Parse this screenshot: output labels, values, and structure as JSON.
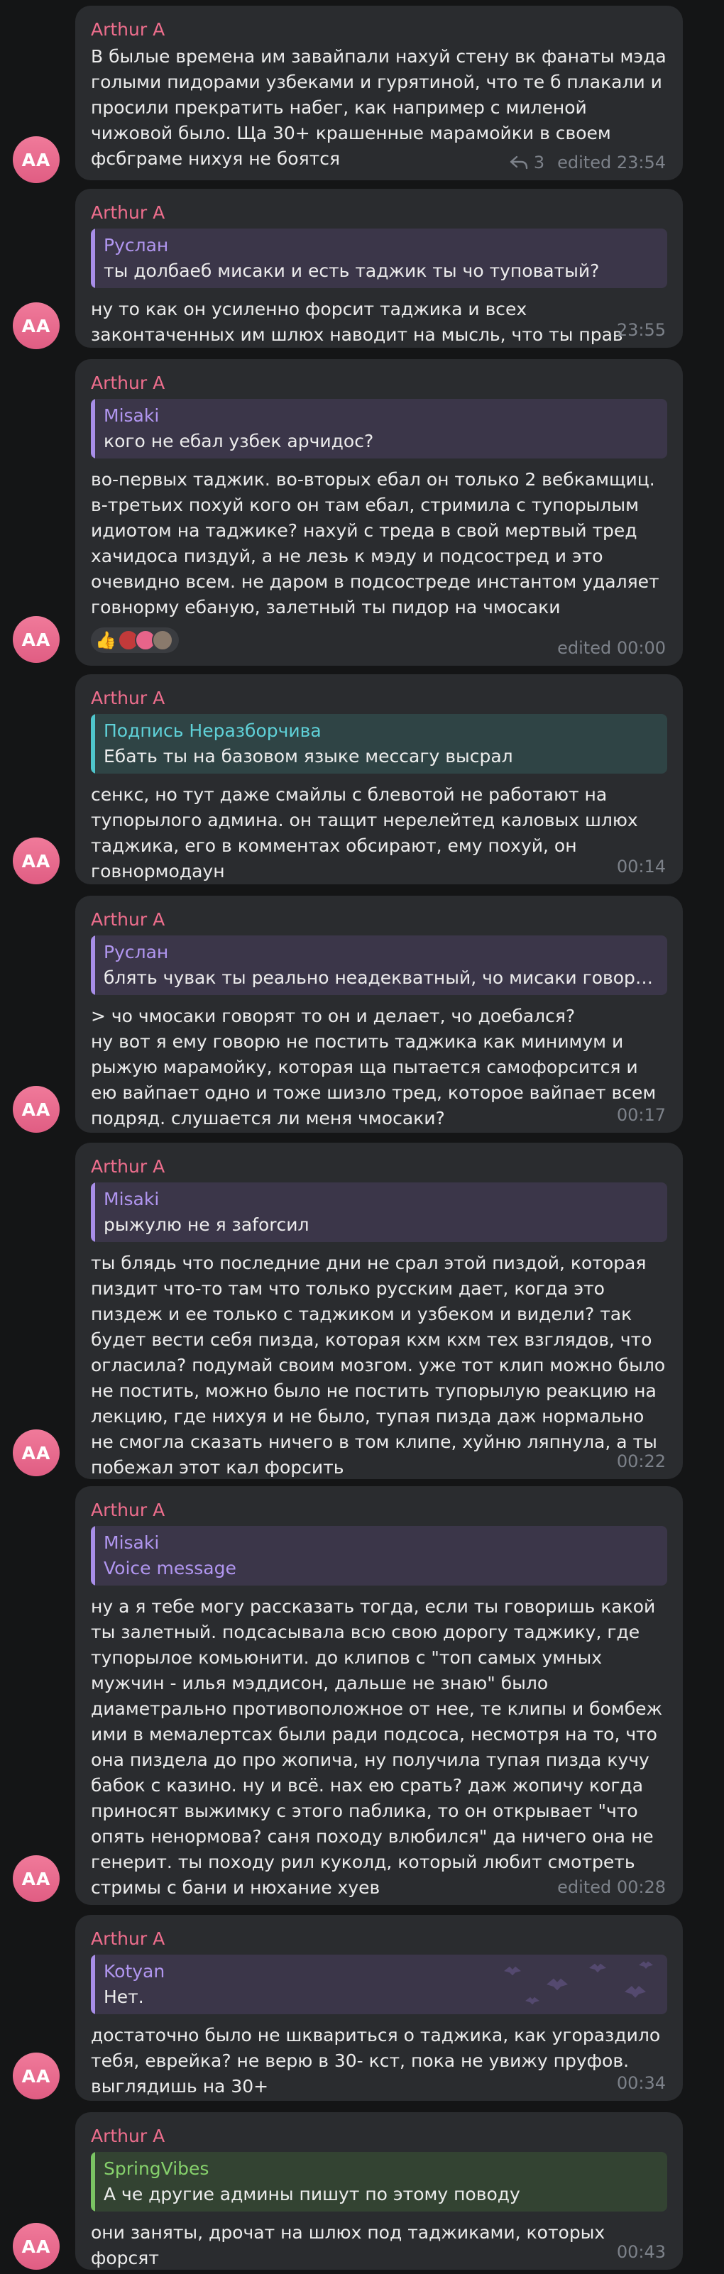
{
  "avatar_initials": "AA",
  "messages": [
    {
      "author": "Arthur A",
      "text": "В былые времена им завайпали нахуй стену вк фанаты мэда голыми пидорами узбеками и гурятиной, что те б плакали и просили прекратить набег, как например с миленой чижовой было. Ща 30+ крашенные марамойки в своем фсбграме нихуя не боятся",
      "reply_count": "3",
      "meta": "edited 23:54"
    },
    {
      "author": "Arthur A",
      "quote_name": "Руслан",
      "quote_text": "ты долбаеб мисаки и есть таджик ты чо туповатый?",
      "text": "ну то как он усиленно форсит таджика и всех законтаченных им шлюх наводит на мысль, что ты прав",
      "meta": "23:55"
    },
    {
      "author": "Arthur A",
      "quote_name": "Misaki",
      "quote_text": "кого не ебал узбек арчидос?",
      "text": "во-первых таджик. во-вторых ебал он только 2 вебкамщиц. в-третьих похуй кого он там ебал, стримила с тупорылым идиотом на таджике? нахуй с треда в свой мертвый тред хачидоса пиздуй, а не лезь к мэду и подсостред и это очевидно всем. не даром в подсостреде инстантом удаляет говнорму ебаную, залетный ты пидор на чмосаки",
      "reaction": "👍",
      "meta": "edited 00:00"
    },
    {
      "author": "Arthur A",
      "quote_name": "Подпись Неразборчива",
      "quote_text": "Ебать ты на базовом языке мессагу высрал",
      "text": "сенкс, но тут даже смайлы с блевотой не работают на тупорылого админа. он тащит нерелейтед каловых шлюх таджика, его в комментах обсирают, ему похуй, он говнормодаун",
      "meta": "00:14"
    },
    {
      "author": "Arthur A",
      "quote_name": "Руслан",
      "quote_text": "блять чувак ты реально неадекватный, чо мисаки говорят ...",
      "text": "> чо чмосаки говорят то он и делает, чо доебался?\nну вот я ему говорю не постить таджика как минимум и рыжую марамойку, которая ща пытается самофорсится и ею вайпает одно и тоже шизло тред, которое вайпает всем подряд. слушается ли меня чмосаки?",
      "meta": "00:17"
    },
    {
      "author": "Arthur A",
      "quote_name": "Misaki",
      "quote_text": "рыжулю не я заforсил",
      "text": "ты блядь что последние дни не срал этой пиздой, которая пиздит что-то там что только русским дает, когда это пиздеж и ее только с таджиком и узбеком и видели? так будет вести себя пизда, которая кхм кхм тех взглядов, что огласила? подумай своим мозгом. уже тот клип можно было не постить, можно было не постить тупорылую реакцию на лекцию, где нихуя и не было, тупая пизда даж нормально не смогла сказать ничего в том клипе, хуйню ляпнула, а ты побежал этот кал форсить",
      "meta": "00:22"
    },
    {
      "author": "Arthur A",
      "quote_name": "Misaki",
      "quote_text": "Voice message",
      "text": "ну а я тебе могу рассказать тогда, если ты говоришь какой ты залетный. подсасывала всю свою дорогу таджику, где тупорылое комьюнити. до клипов с \"топ самых умных мужчин - илья мэддисон, дальше не знаю\" было диаметрально противоположное от нее, те клипы и бомбеж ими в мемалертсах были ради подсоса, несмотря на то, что она пиздела до про жопича, ну получила тупая пизда кучу бабок с казино. ну и всё. нах ею срать? даж жопичу когда приносят выжимку с этого паблика, то он открывает \"что опять ненормова? саня походу влюбился\" да ничего она не генерит. ты походу рил куколд, который любит смотреть стримы с бани и нюхание хуев",
      "meta": "edited 00:28"
    },
    {
      "author": "Arthur A",
      "quote_name": "Kotyan",
      "quote_text": "Нет.",
      "text": "достаточно было не шквариться о таджика, как угораздило тебя, еврейка? не верю в 30- кст, пока не увижу пруфов. выглядишь на 30+",
      "meta": "00:34"
    },
    {
      "author": "Arthur A",
      "quote_name": "SpringVibes",
      "quote_text": "А че другие админы пишут по этому поводу",
      "text": "они заняты, дрочат на шлюх под таджиками, которых форсят",
      "meta": "00:43"
    }
  ]
}
